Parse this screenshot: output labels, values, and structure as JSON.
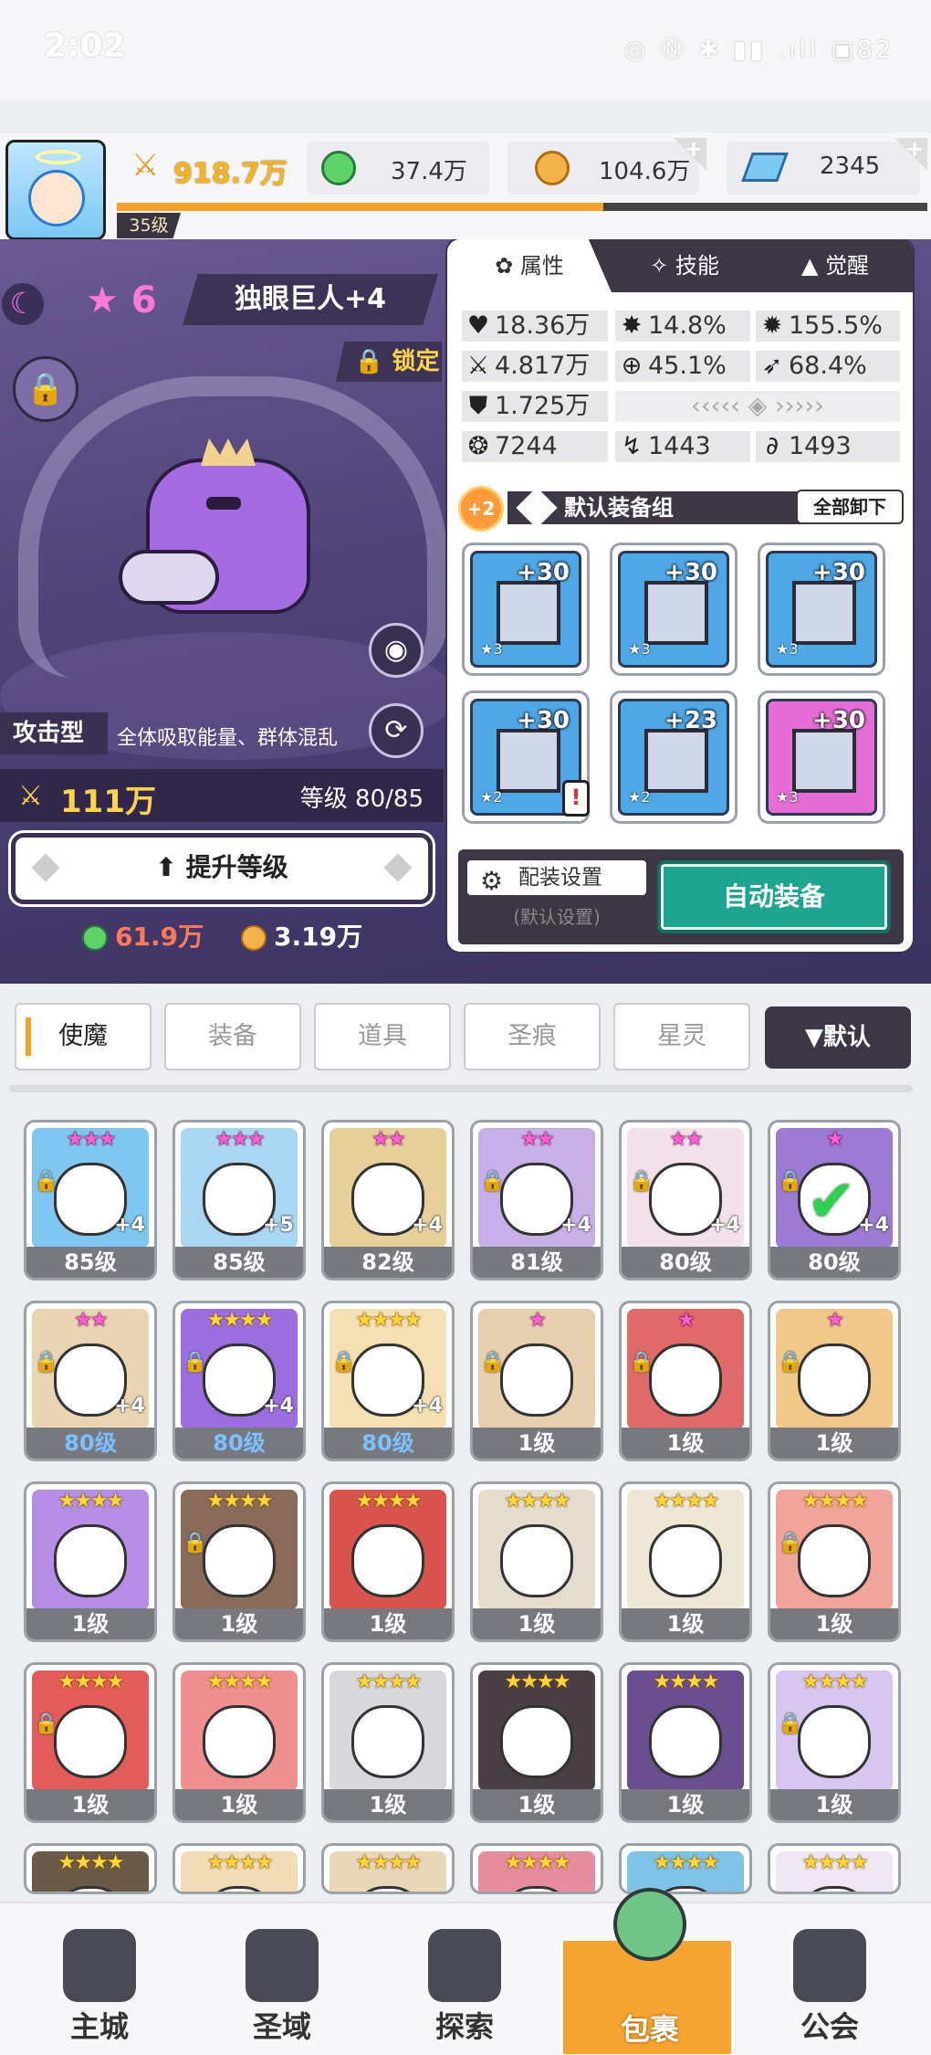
{
  "status": {
    "time": "2:02",
    "icons": "◎ Ⓝ ✱ ▮▮ .ıll ▣82"
  },
  "header": {
    "level": "35级",
    "power": "918.7万",
    "green_gem": "37.4万",
    "gold": "104.6万",
    "diamond": "2345",
    "xp_fraction": 0.6,
    "accent": "#f6a22a"
  },
  "hero": {
    "stars": "6",
    "name": "独眼巨人+4",
    "lock_label": "锁定",
    "type": "攻击型",
    "skill_desc": "全体吸取能量、群体混乱",
    "power": "111万",
    "level_text": "等级 80/85",
    "upgrade_label": "提升等级",
    "cost_green": "61.9万",
    "cost_gold": "3.19万"
  },
  "card": {
    "tabs": [
      "属性",
      "技能",
      "觉醒"
    ],
    "stats": {
      "hp": "18.36万",
      "crit": "14.8%",
      "crit_dmg": "155.5%",
      "atk": "4.817万",
      "hit": "45.1%",
      "dodge": "68.4%",
      "def": "1.725万",
      "s1": "7244",
      "s2": "1443",
      "s3": "1493"
    },
    "gear_badge": "+2",
    "gear_title": "默认装备组",
    "unload_label": "全部卸下",
    "equipment": [
      {
        "name": "sword",
        "level": "+30",
        "stars": "★3"
      },
      {
        "name": "helmet",
        "level": "+30",
        "stars": "★3"
      },
      {
        "name": "armor",
        "level": "+30",
        "stars": "★3"
      },
      {
        "name": "belt",
        "level": "+30",
        "stars": "★2",
        "warn": "!"
      },
      {
        "name": "necklace",
        "level": "+23",
        "stars": "★2"
      },
      {
        "name": "boots",
        "level": "+30",
        "stars": "★3"
      }
    ],
    "config_label": "配装设置",
    "config_sub": "(默认设置)",
    "auto_label": "自动装备"
  },
  "inventory": {
    "tabs": [
      "使魔",
      "装备",
      "道具",
      "圣痕",
      "星灵"
    ],
    "sort_label": "▼默认",
    "cells": [
      {
        "stars": "★★★",
        "pink": true,
        "lv": "85级",
        "plus": "+4",
        "lock": true,
        "color": "#7fc7f0"
      },
      {
        "stars": "★★★",
        "pink": true,
        "lv": "85级",
        "plus": "+5",
        "lock": false,
        "color": "#a9d6f2"
      },
      {
        "stars": "★★",
        "pink": true,
        "lv": "82级",
        "plus": "+4",
        "lock": false,
        "color": "#e7cf9a"
      },
      {
        "stars": "★★",
        "pink": true,
        "lv": "81级",
        "plus": "+4",
        "lock": true,
        "color": "#c7b0e6"
      },
      {
        "stars": "★★",
        "pink": true,
        "lv": "80级",
        "plus": "+4",
        "lock": true,
        "color": "#f2e0ea"
      },
      {
        "stars": "★",
        "pink": true,
        "lv": "80级",
        "plus": "+4",
        "lock": true,
        "color": "#9d7ad3",
        "check": true
      },
      {
        "stars": "★★",
        "pink": true,
        "lv": "80级",
        "plus": "+4",
        "lock": true,
        "color": "#e9d5b4",
        "blue": true
      },
      {
        "stars": "★★★★",
        "pink": false,
        "lv": "80级",
        "plus": "+4",
        "lock": true,
        "color": "#9b6ee0",
        "blue": true
      },
      {
        "stars": "★★★★",
        "pink": false,
        "lv": "80级",
        "plus": "+4",
        "lock": true,
        "color": "#f4e0b2",
        "blue": true
      },
      {
        "stars": "★",
        "pink": true,
        "lv": "1级",
        "plus": "",
        "lock": true,
        "color": "#e6cfae"
      },
      {
        "stars": "★",
        "pink": true,
        "lv": "1级",
        "plus": "",
        "lock": true,
        "color": "#e06a6a"
      },
      {
        "stars": "★",
        "pink": true,
        "lv": "1级",
        "plus": "",
        "lock": true,
        "color": "#f1c88a"
      },
      {
        "stars": "★★★★",
        "pink": false,
        "lv": "1级",
        "plus": "",
        "lock": false,
        "color": "#b68ee6"
      },
      {
        "stars": "★★★★",
        "pink": false,
        "lv": "1级",
        "plus": "",
        "lock": true,
        "color": "#8a6a5a"
      },
      {
        "stars": "★★★★",
        "pink": false,
        "lv": "1级",
        "plus": "",
        "lock": false,
        "color": "#d9544f"
      },
      {
        "stars": "★★★★",
        "pink": false,
        "lv": "1级",
        "plus": "",
        "lock": false,
        "color": "#e4dccc"
      },
      {
        "stars": "★★★★",
        "pink": false,
        "lv": "1级",
        "plus": "",
        "lock": false,
        "color": "#efe7d6"
      },
      {
        "stars": "★★★★",
        "pink": false,
        "lv": "1级",
        "plus": "",
        "lock": true,
        "color": "#f1a49a"
      },
      {
        "stars": "★★★★",
        "pink": false,
        "lv": "1级",
        "plus": "",
        "lock": true,
        "color": "#e35b5b"
      },
      {
        "stars": "★★★★",
        "pink": false,
        "lv": "1级",
        "plus": "",
        "lock": false,
        "color": "#ef8f8f"
      },
      {
        "stars": "★★★★",
        "pink": false,
        "lv": "1级",
        "plus": "",
        "lock": false,
        "color": "#d8d8dc"
      },
      {
        "stars": "★★★★",
        "pink": false,
        "lv": "1级",
        "plus": "",
        "lock": false,
        "color": "#4b3f46"
      },
      {
        "stars": "★★★★",
        "pink": false,
        "lv": "1级",
        "plus": "",
        "lock": false,
        "color": "#6b4e8f"
      },
      {
        "stars": "★★★★",
        "pink": false,
        "lv": "1级",
        "plus": "",
        "lock": true,
        "color": "#d7c6ef"
      },
      {
        "stars": "★★★★",
        "pink": false,
        "lv": "",
        "plus": "",
        "lock": false,
        "color": "#6a5a4a"
      },
      {
        "stars": "★★★★",
        "pink": false,
        "lv": "",
        "plus": "",
        "lock": false,
        "color": "#f2dcb8"
      },
      {
        "stars": "★★★★",
        "pink": false,
        "lv": "",
        "plus": "",
        "lock": false,
        "color": "#e8d7b8"
      },
      {
        "stars": "★★★★",
        "pink": false,
        "lv": "",
        "plus": "",
        "lock": false,
        "color": "#e68da0"
      },
      {
        "stars": "★★★★",
        "pink": false,
        "lv": "",
        "plus": "",
        "lock": false,
        "color": "#7fc3e8"
      },
      {
        "stars": "★★★★",
        "pink": false,
        "lv": "",
        "plus": "",
        "lock": false,
        "color": "#eee6f2"
      }
    ]
  },
  "nav": [
    {
      "label": "主城",
      "icon": "castle-icon"
    },
    {
      "label": "圣域",
      "icon": "vortex-icon"
    },
    {
      "label": "探索",
      "icon": "sword-rock-icon"
    },
    {
      "label": "包裹",
      "icon": "backpack-icon",
      "active": true
    },
    {
      "label": "公会",
      "icon": "guild-helmet-icon"
    }
  ]
}
